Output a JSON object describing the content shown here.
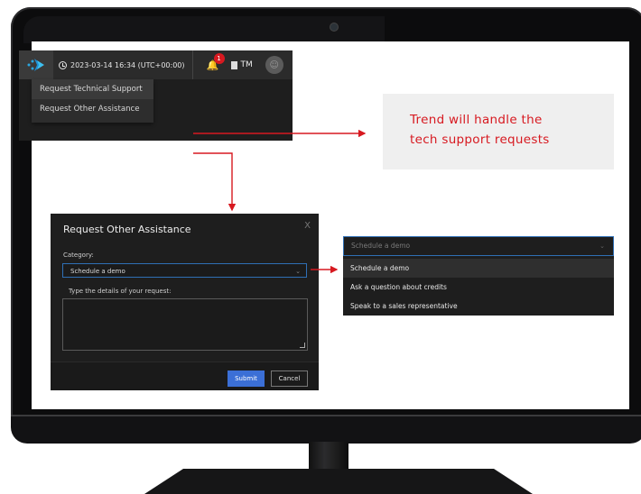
{
  "topbar": {
    "datetime": "2023-03-14 16:34 (UTC+00:00)",
    "notification_count": "1",
    "account_label": "TM"
  },
  "menu": {
    "items": [
      "Request Technical Support",
      "Request Other Assistance"
    ]
  },
  "callout": {
    "line1": "Trend will handle the",
    "line2": "tech support requests"
  },
  "dialog": {
    "title": "Request Other Assistance",
    "close": "X",
    "category_label": "Category:",
    "category_value": "Schedule a demo",
    "details_label": "Type the details of your request:",
    "submit": "Submit",
    "cancel": "Cancel"
  },
  "dropdown": {
    "placeholder": "Schedule a demo",
    "options": [
      "Schedule a demo",
      "Ask a question about credits",
      "Speak to a sales representative"
    ],
    "selected_index": 0
  },
  "colors": {
    "accent_red": "#d71920",
    "primary_button": "#3b6fd6",
    "focus_border": "#2f6fb5",
    "dark_panel": "#1e1e1e"
  },
  "icons": [
    "logo-icon",
    "clock-icon",
    "bell-icon",
    "document-icon",
    "user-avatar-icon",
    "chevron-down-icon",
    "close-icon"
  ]
}
